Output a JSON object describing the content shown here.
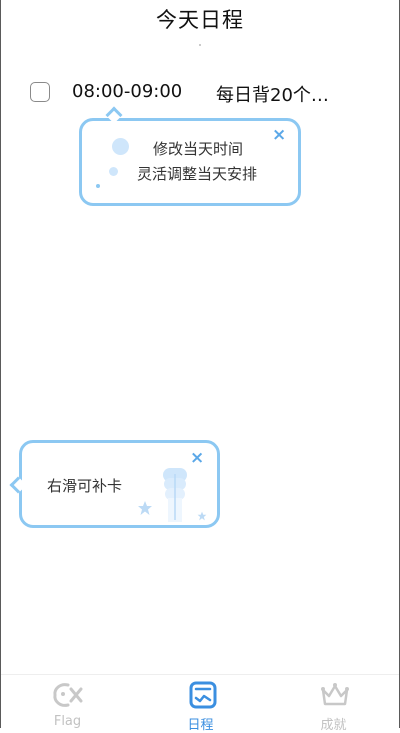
{
  "header": {
    "title": "今天日程"
  },
  "task": {
    "time": "08:00-09:00",
    "title": "每日背20个…"
  },
  "tip_edit": {
    "line1": "修改当天时间",
    "line2": "灵活调整当天安排",
    "close": "×"
  },
  "tip_swipe": {
    "text": "右滑可补卡",
    "close": "×"
  },
  "tabbar": {
    "tabs": [
      {
        "label": "Flag",
        "icon": "fish-icon",
        "active": false
      },
      {
        "label": "日程",
        "icon": "calendar-icon",
        "active": true
      },
      {
        "label": "成就",
        "icon": "crown-icon",
        "active": false
      }
    ]
  },
  "colors": {
    "accent": "#3b8fe0",
    "tip_border": "#8cc8f2",
    "inactive": "#c2c2c2"
  }
}
